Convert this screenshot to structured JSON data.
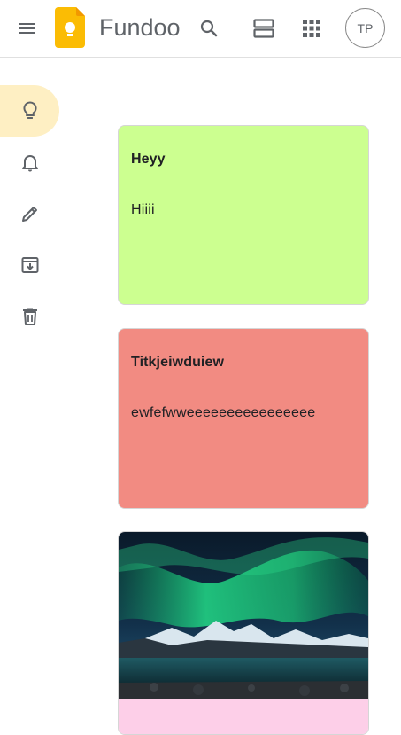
{
  "app": {
    "title": "Fundoo",
    "avatar_initials": "TP"
  },
  "header": {
    "icons": [
      "menu-icon",
      "keep-logo-icon",
      "search-icon",
      "list-view-icon",
      "apps-grid-icon"
    ]
  },
  "sidebar": {
    "items": [
      {
        "icon": "lightbulb-icon",
        "name": "notes",
        "active": true
      },
      {
        "icon": "bell-icon",
        "name": "reminders",
        "active": false
      },
      {
        "icon": "pencil-icon",
        "name": "edit-labels",
        "active": false
      },
      {
        "icon": "archive-icon",
        "name": "archive",
        "active": false
      },
      {
        "icon": "trash-icon",
        "name": "trash",
        "active": false
      }
    ]
  },
  "notes": [
    {
      "title": "Heyy",
      "body": "Hiiii",
      "color": "#ccff90"
    },
    {
      "title": "Titkjeiwduiew",
      "body": "ewfefwweeeeeeeeeeeeeeee",
      "color": "#f28b82"
    },
    {
      "image": "aurora-borealis-over-mountains",
      "footer_color": "#fdcfe8"
    }
  ],
  "colors": {
    "active_sidebar": "#feefc3",
    "logo_yellow": "#fbbc04"
  }
}
